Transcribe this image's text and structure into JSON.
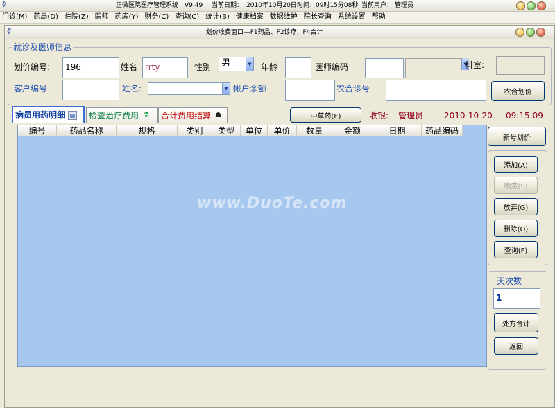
{
  "app": {
    "title": "正微医院医疗管理系统",
    "version": "V9.49",
    "date_label": "当前日期：",
    "date_value": "2010年10月20日",
    "time_label": "时间：",
    "time_value": "09时15分08秒",
    "user_label": "当前用户：",
    "user_value": "管理员"
  },
  "menu": [
    "门诊(M)",
    "药局(D)",
    "住院(Z)",
    "医师",
    "药库(Y)",
    "财务(C)",
    "查询(C)",
    "统计(B)",
    "健康档案",
    "数据维护",
    "院长查询",
    "系统设置",
    "帮助"
  ],
  "window": {
    "title": "划价收费窗口---F1药品、F2诊疗、F4合计"
  },
  "patient_group": {
    "legend": "就诊及医师信息",
    "billing_no_label": "划价编号:",
    "billing_no_value": "196",
    "name_label": "姓名",
    "name_value": "rrty",
    "gender_label": "性别",
    "gender_value": "男",
    "age_label": "年龄",
    "age_value": "",
    "doctor_code_label": "医师编码",
    "doctor_code_value": "",
    "doctor_select_value": "",
    "dept_label": "科室:",
    "dept_value": "",
    "customer_no_label": "客户编号",
    "customer_no_value": "",
    "customer_name_label": "姓名:",
    "customer_name_value": "",
    "balance_label": "帐户余额",
    "balance_value": "",
    "rural_label": "农合诊号",
    "rural_value": "",
    "rural_button": "农合划价"
  },
  "tabs": [
    {
      "label": "病员用药明细",
      "icon": "list-icon"
    },
    {
      "label": "检查治疗费用",
      "icon": "flask-icon"
    },
    {
      "label": "合计费用结算",
      "icon": "person-icon"
    }
  ],
  "herbal_button": "中草药(E)",
  "status": {
    "cashier_label": "收银:",
    "cashier_value": "管理员",
    "date": "2010-10-20",
    "time": "09:15:09"
  },
  "grid": {
    "columns": [
      "编号",
      "药品名称",
      "规格",
      "类别",
      "类型",
      "单位",
      "单价",
      "数量",
      "金额",
      "日期",
      "药品编码"
    ],
    "rows": []
  },
  "watermark": "www.DuoTe.com",
  "side_buttons": {
    "new_billing": "新号划价",
    "add": "添加(A)",
    "confirm": "确定(S)",
    "discard": "放弃(G)",
    "delete": "删除(O)",
    "query": "查询(F)",
    "days_label": "天次数",
    "days_value": "1",
    "prescription_total": "处方合计",
    "return": "返回"
  }
}
